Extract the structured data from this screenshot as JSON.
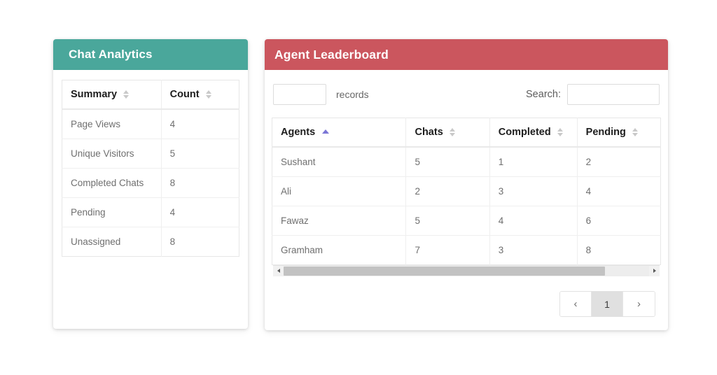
{
  "analytics_card": {
    "title": "Chat Analytics",
    "header_color": "#4aa79b",
    "columns": [
      {
        "label": "Summary",
        "sort": "both"
      },
      {
        "label": "Count",
        "sort": "both"
      }
    ],
    "rows": [
      {
        "summary": "Page Views",
        "count": "4"
      },
      {
        "summary": "Unique Visitors",
        "count": "5"
      },
      {
        "summary": "Completed Chats",
        "count": "8"
      },
      {
        "summary": "Pending",
        "count": "4"
      },
      {
        "summary": "Unassigned",
        "count": "8"
      }
    ]
  },
  "leaderboard_card": {
    "title": "Agent Leaderboard",
    "header_color": "#cb565e",
    "controls": {
      "length_value": "",
      "length_placeholder": "",
      "length_label": "records",
      "search_label": "Search:",
      "search_value": "",
      "search_placeholder": ""
    },
    "columns": [
      {
        "label": "Agents",
        "sort": "asc"
      },
      {
        "label": "Chats",
        "sort": "both"
      },
      {
        "label": "Completed",
        "sort": "both"
      },
      {
        "label": "Pending",
        "sort": "both"
      }
    ],
    "rows": [
      {
        "agent": "Sushant",
        "chats": "5",
        "completed": "1",
        "pending": "2"
      },
      {
        "agent": "Ali",
        "chats": "2",
        "completed": "3",
        "pending": "4"
      },
      {
        "agent": "Fawaz",
        "chats": "5",
        "completed": "4",
        "pending": "6"
      },
      {
        "agent": "Gramham",
        "chats": "7",
        "completed": "3",
        "pending": "8"
      }
    ],
    "scrollbar": {
      "left_arrow": "left-arrow-icon",
      "right_arrow": "right-arrow-icon"
    },
    "pagination": {
      "previous": "‹",
      "next": "›",
      "pages": [
        "1"
      ],
      "active_page": "1"
    }
  }
}
